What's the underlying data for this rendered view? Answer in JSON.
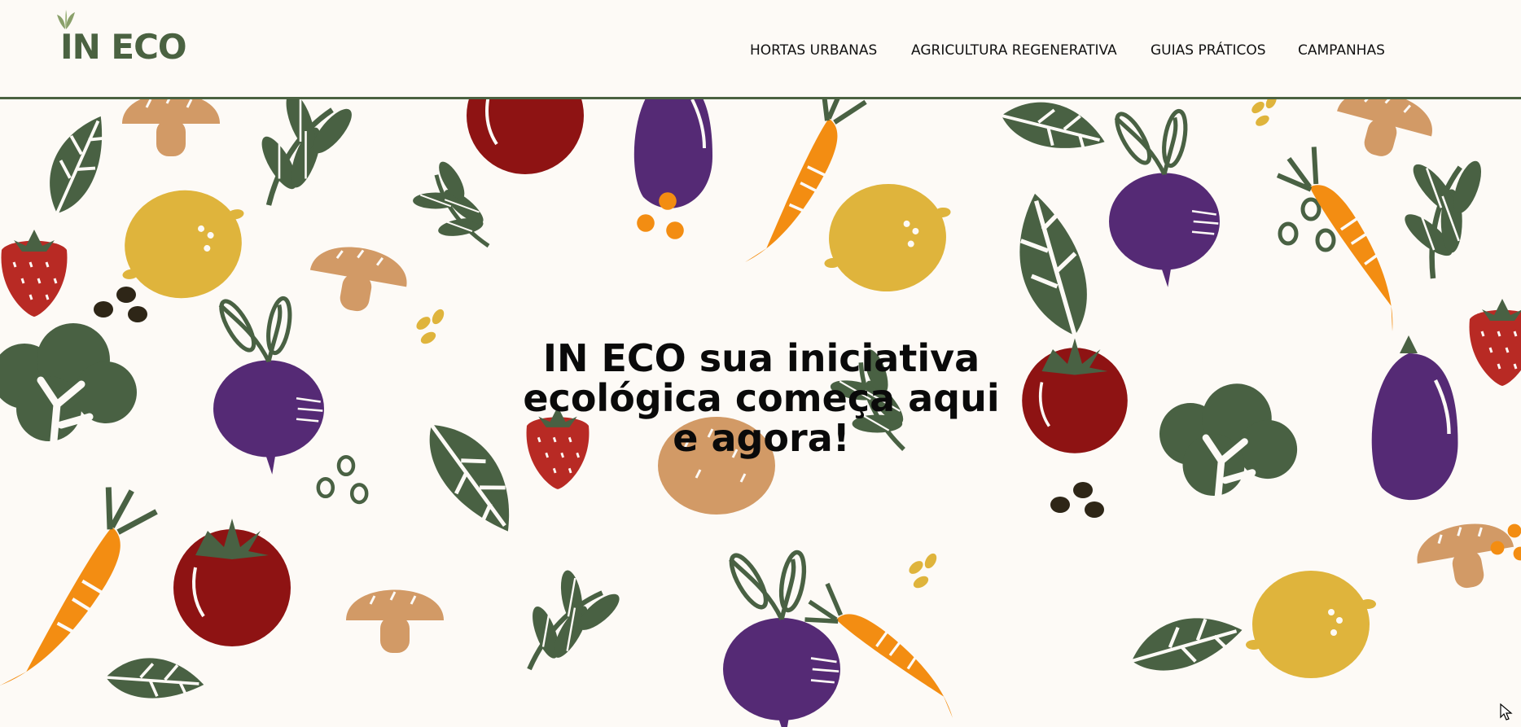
{
  "logo": {
    "text": "IN ECO",
    "icon": "leaf-sprout-icon",
    "color": "#4a6241"
  },
  "nav": {
    "items": [
      {
        "label": "HORTAS URBANAS"
      },
      {
        "label": "AGRICULTURA REGENERATIVA"
      },
      {
        "label": "GUIAS PRÁTICOS"
      },
      {
        "label": "CAMPANHAS"
      }
    ]
  },
  "hero": {
    "headline_lines": [
      "IN ECO sua iniciativa",
      "ecológica começa aqui",
      "e agora!"
    ],
    "background": "vegetable-pattern-illustration"
  },
  "colors": {
    "background": "#fdfaf6",
    "accent_green": "#4a6241",
    "carrot": "#f38d12",
    "beet": "#552a75",
    "tomato": "#8e1313",
    "lemon": "#dfb43c",
    "potato": "#d29a66"
  }
}
